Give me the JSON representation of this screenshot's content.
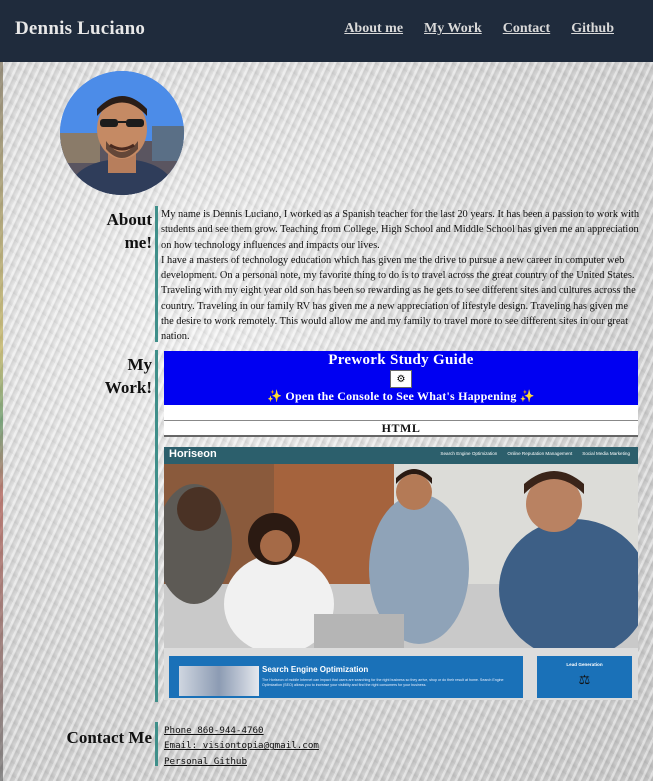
{
  "header": {
    "site_title": "Dennis Luciano",
    "nav": [
      "About me",
      "My Work",
      "Contact",
      "Github"
    ]
  },
  "about": {
    "heading_line1": "About",
    "heading_line2": "me!",
    "paragraph1": "My name is Dennis Luciano, I worked as a Spanish teacher for the last 20 years. It has been a passion to work with students and see them grow. Teaching from College, High School and Middle School has given me an appreciation on how technology influences and impacts our lives.",
    "paragraph2": "I have a masters of technology education which has given me the drive to pursue a new career in computer web development. On a personal note, my favorite thing to do is to travel across the great country of the United States. Traveling with my eight year old son has been so rewarding as he gets to see different sites and cultures across the country. Traveling in our family RV has given me a new appreciation of lifestyle design. Traveling has given me the desire to work remotely. This would allow me and my family to travel more to see different sites in our great nation."
  },
  "work": {
    "heading_line1": "My",
    "heading_line2": "Work!",
    "prework": {
      "title": "Prework Study Guide",
      "subtitle": "Open the Console to See What's Happening",
      "section": "HTML",
      "banner_color": "#0000f2"
    },
    "horiseon": {
      "brand": "Horiseon",
      "nav": [
        "Search Engine Optimization",
        "Online Reputation Management",
        "Social Media Marketing"
      ],
      "feature_title": "Search Engine Optimization",
      "feature_text": "The Horiseon of mobile Internet can impact that users are searching for the right business so they arrive, shop or do their result at home. Search Engine Optimization (SEO) allows you to increase your visibility and find the right consumers for your business.",
      "side_title": "Lead Generation",
      "accent_color": "#1a71b8"
    }
  },
  "contact": {
    "heading": "Contact Me",
    "phone": "Phone 860-944-4760",
    "email": "Email: visiontopia@gmail.com",
    "github": "Personal Github"
  },
  "colors": {
    "header_bg": "#1f2b3c",
    "section_rule": "#3f8f8a"
  }
}
